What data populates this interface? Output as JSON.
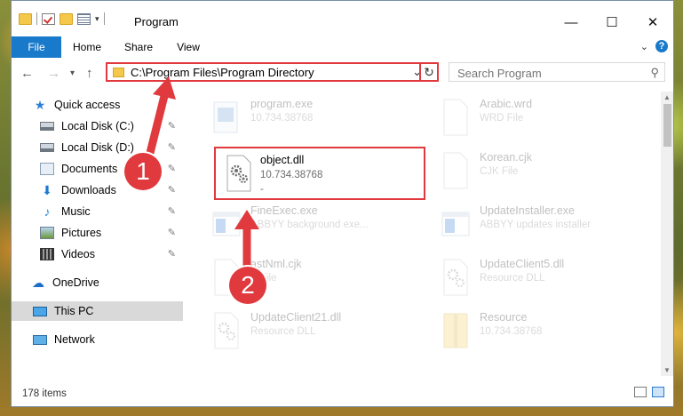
{
  "window": {
    "title": "Program"
  },
  "qat": {
    "dropdown": "▾"
  },
  "ribbon": {
    "tabs": [
      "File",
      "Home",
      "Share",
      "View"
    ],
    "help": "?"
  },
  "nav": {
    "back": "←",
    "forward": "→",
    "dropdown": "▾",
    "up": "↑",
    "address": "C:\\Program Files\\Program Directory",
    "address_chevron": "⌄",
    "refresh": "↻",
    "search_placeholder": "Search Program",
    "search_icon": "⚲"
  },
  "sidebar": {
    "quick_access": "Quick access",
    "items": [
      {
        "label": "Local Disk (C:)",
        "icon": "drive-icon",
        "pinned": true
      },
      {
        "label": "Local Disk (D:)",
        "icon": "drive-icon",
        "pinned": true
      },
      {
        "label": "Documents",
        "icon": "documents-icon",
        "pinned": true
      },
      {
        "label": "Downloads",
        "icon": "download-icon",
        "pinned": true
      },
      {
        "label": "Music",
        "icon": "music-icon",
        "pinned": true
      },
      {
        "label": "Pictures",
        "icon": "pictures-icon",
        "pinned": true
      },
      {
        "label": "Videos",
        "icon": "videos-icon",
        "pinned": true
      }
    ],
    "onedrive": "OneDrive",
    "this_pc": "This PC",
    "network": "Network",
    "pin_glyph": "📌"
  },
  "files": [
    {
      "name": "program.exe",
      "line1": "10.734.38768",
      "line2": ""
    },
    {
      "name": "Arabic.wrd",
      "line1": "WRD File",
      "line2": ""
    },
    {
      "name": "object.dll",
      "line1": "10.734.38768",
      "line2": "-"
    },
    {
      "name": "Korean.cjk",
      "line1": "CJK File",
      "line2": ""
    },
    {
      "name": "FineExec.exe",
      "line1": "ABBYY background exe...",
      "line2": ""
    },
    {
      "name": "UpdateInstaller.exe",
      "line1": "ABBYY updates installer",
      "line2": ""
    },
    {
      "name": "astNml.cjk",
      "line1": "K File",
      "line2": ""
    },
    {
      "name": "UpdateClient5.dll",
      "line1": "Resource DLL",
      "line2": ""
    },
    {
      "name": "UpdateClient21.dll",
      "line1": "Resource DLL",
      "line2": ""
    },
    {
      "name": "Resource",
      "line1": "10.734.38768",
      "line2": ""
    }
  ],
  "status": {
    "item_count": "178 items"
  },
  "annotations": {
    "step1": "1",
    "step2": "2",
    "color": "#e0393e"
  }
}
